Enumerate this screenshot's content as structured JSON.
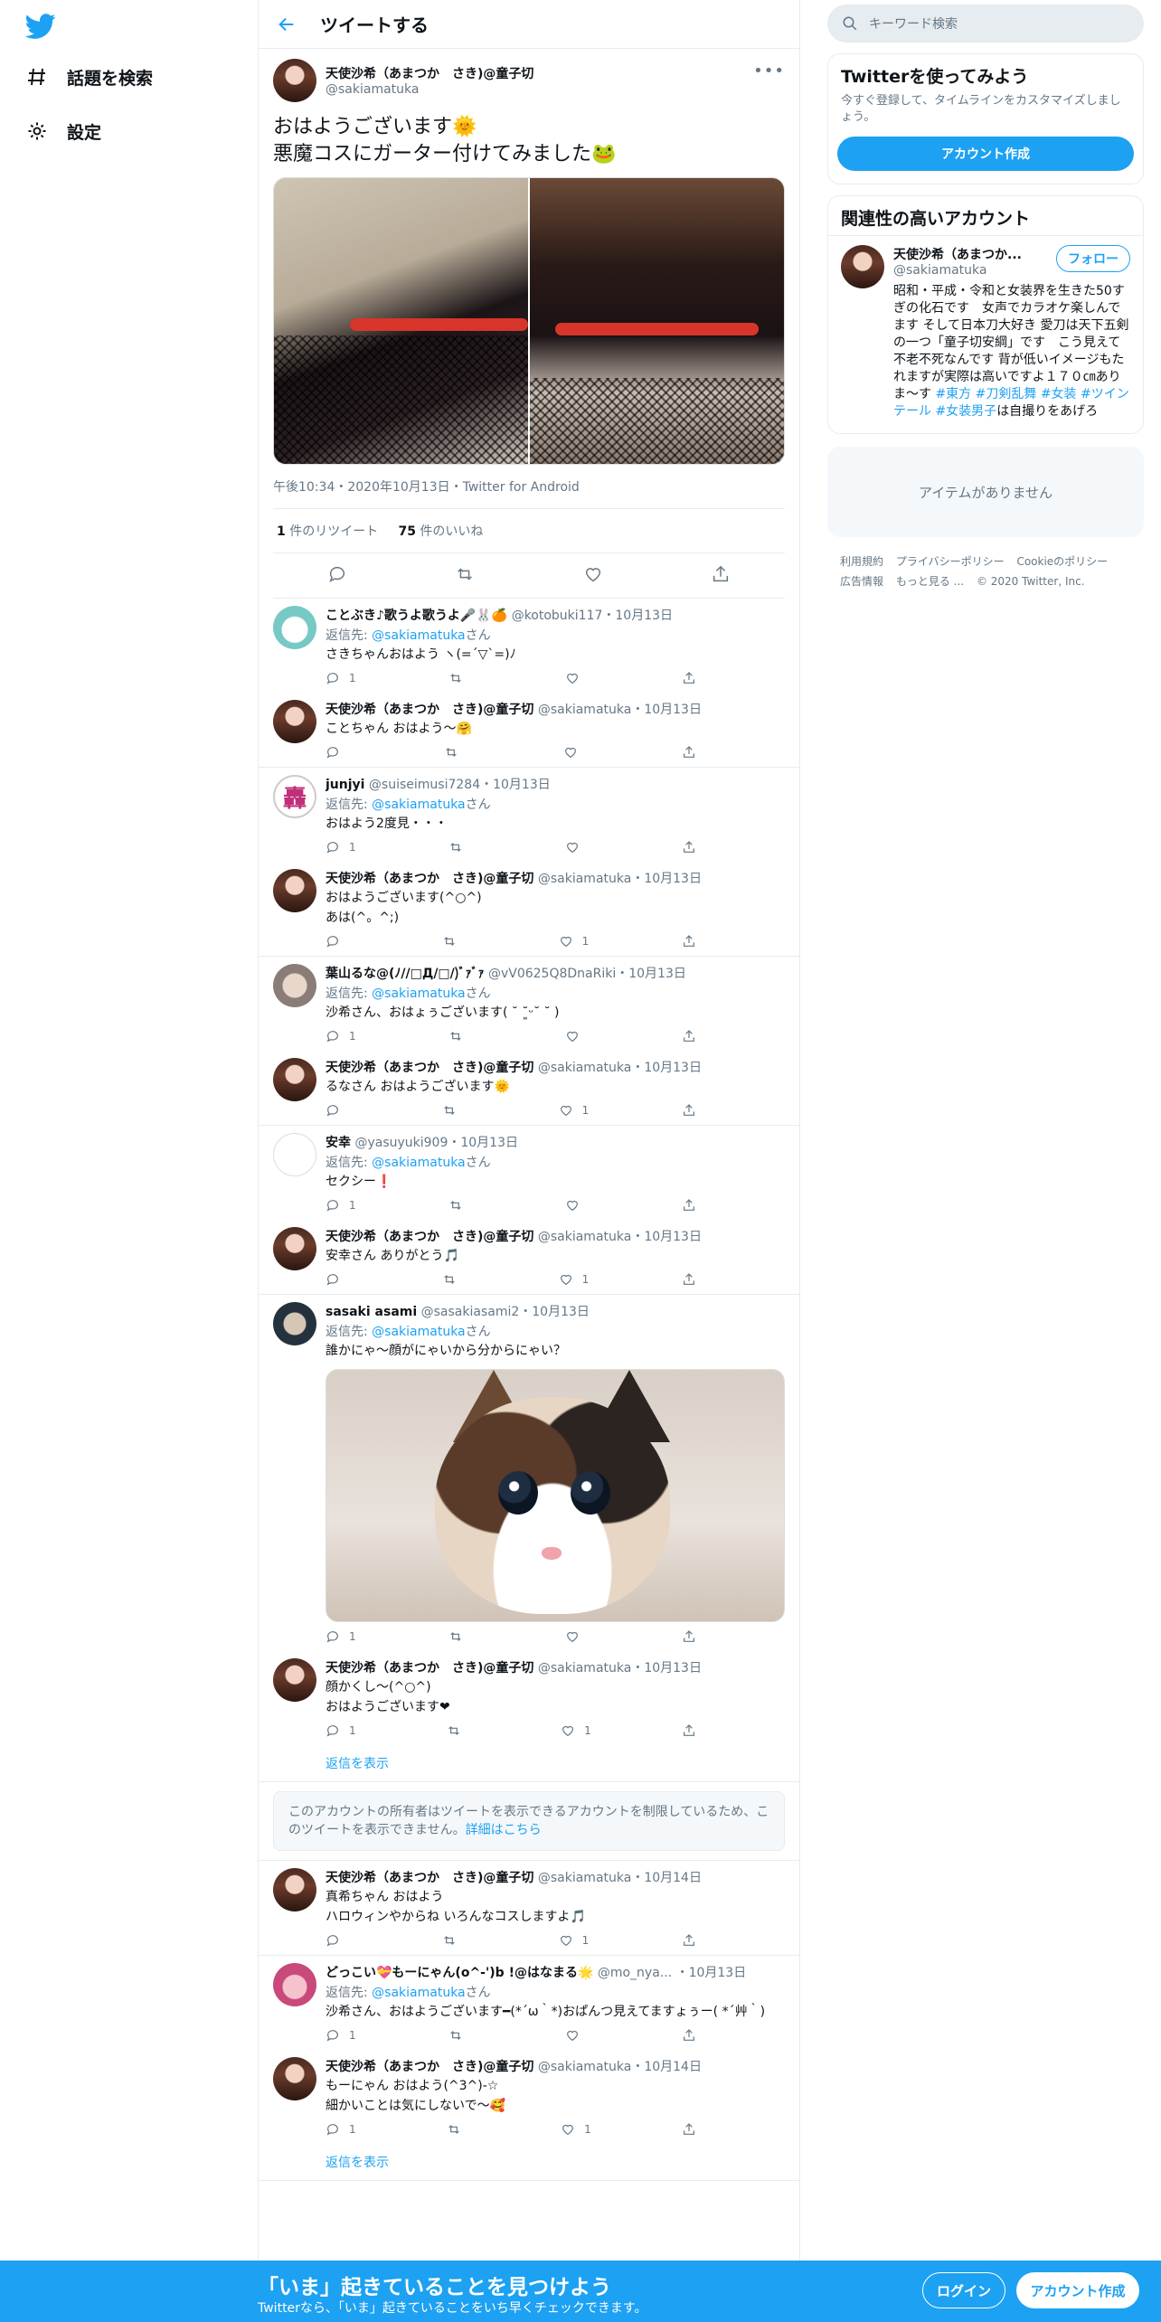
{
  "nav": {
    "explore": "話題を検索",
    "settings": "設定"
  },
  "header": {
    "title": "ツイートする"
  },
  "focal": {
    "name": "天使沙希（あまつか　さき)@童子切",
    "handle": "@sakiamatuka",
    "text_line1": "おはようございます🌞",
    "text_line2": "悪魔コスにガーター付けてみました🐸",
    "meta": "午後10:34・2020年10月13日・Twitter for Android",
    "retweets_num": "1",
    "retweets_label": "件のリツイート",
    "likes_num": "75",
    "likes_label": "件のいいね"
  },
  "reply_prefix": "返信先:",
  "reply_suffix": "さん",
  "tweets": [
    {
      "name": "ことぶき♪歌うよ歌うよ🎤🐰🍊",
      "handle": "@kotobuki117・10月13日",
      "reply_to": "@sakiamatuka",
      "text": "さきちゃんおはよう ヽ(=´▽`=)ﾉ",
      "replies": "1",
      "likes": ""
    },
    {
      "name": "天使沙希（あまつか　さき)@童子切",
      "handle": "@sakiamatuka・10月13日",
      "text": "ことちゃん おはよう〜🤗",
      "replies": "",
      "likes": ""
    },
    {
      "name": "junjyi",
      "handle": "@suiseimusi7284・10月13日",
      "reply_to": "@sakiamatuka",
      "text": "おはよう2度見・・・",
      "replies": "1",
      "likes": ""
    },
    {
      "name": "天使沙希（あまつか　さき)@童子切",
      "handle": "@sakiamatuka・10月13日",
      "text": "おはようございます(^○^)",
      "text2": "あは(^。^;)",
      "replies": "",
      "likes": "1"
    },
    {
      "name": "葉山るな@(ﾉ//□Д/□/)ﾞｧﾞｧ",
      "handle": "@vV0625Q8DnaRiki・10月13日",
      "reply_to": "@sakiamatuka",
      "text": "沙希さん、おはょぅございます( ˘ ˘͈ᵕ˘ ˘ )",
      "replies": "1",
      "likes": ""
    },
    {
      "name": "天使沙希（あまつか　さき)@童子切",
      "handle": "@sakiamatuka・10月13日",
      "text": "るなさん おはようございます🌞",
      "replies": "",
      "likes": "1"
    },
    {
      "name": "安幸",
      "handle": "@yasuyuki909・10月13日",
      "reply_to": "@sakiamatuka",
      "text": "セクシー❗",
      "replies": "1",
      "likes": ""
    },
    {
      "name": "天使沙希（あまつか　さき)@童子切",
      "handle": "@sakiamatuka・10月13日",
      "text": "安幸さん ありがとう🎵",
      "replies": "",
      "likes": "1"
    },
    {
      "name": "sasaki asami",
      "handle": "@sasakiasami2・10月13日",
      "reply_to": "@sakiamatuka",
      "text": "誰かにゃ〜顔がにゃいから分からにゃい？",
      "replies": "1",
      "likes": ""
    },
    {
      "name": "天使沙希（あまつか　さき)@童子切",
      "handle": "@sakiamatuka・10月13日",
      "text": "顔かくし〜(^○^)",
      "text2": "おはようございます❤",
      "replies": "1",
      "likes": "1"
    },
    {
      "name": "天使沙希（あまつか　さき)@童子切",
      "handle": "@sakiamatuka・10月14日",
      "text": "真希ちゃん おはよう",
      "text2": "ハロウィンやからね いろんなコスしますよ🎵",
      "replies": "",
      "likes": "1"
    },
    {
      "name": "どっこい💝もーにゃん(o^-')b !@はなまる🌟",
      "handle": "@mo_nya... ・10月13日",
      "reply_to": "@sakiamatuka",
      "text": "沙希さん、おはようございます━(*´ω｀*)おぱんつ見えてますょぅー( *´艸｀)",
      "replies": "1",
      "likes": ""
    },
    {
      "name": "天使沙希（あまつか　さき)@童子切",
      "handle": "@sakiamatuka・10月14日",
      "text": "もーにゃん おはよう(^3^)-☆",
      "text2": "細かいことは気にしないで〜🥰",
      "replies": "1",
      "likes": "1"
    }
  ],
  "show_replies": "返信を表示",
  "notice": {
    "text": "このアカウントの所有者はツイートを表示できるアカウントを制限しているため、このツイートを表示できません。",
    "link": "詳細はこちら"
  },
  "search": {
    "placeholder": "キーワード検索"
  },
  "signup_card": {
    "title": "Twitterを使ってみよう",
    "sub": "今すぐ登録して、タイムラインをカスタマイズしましょう。",
    "button": "アカウント作成"
  },
  "related": {
    "title": "関連性の高いアカウント",
    "name": "天使沙希（あまつか...",
    "handle": "@sakiamatuka",
    "follow": "フォロー",
    "desc": "昭和・平成・令和と女装界を生きた50すぎの化石です　女声でカラオケ楽しんでます そして日本刀大好き 愛刀は天下五剣の一つ「童子切安綱」です　こう見えて不老不死なんです 背が低いイメージもたれますが実際は高いですよ１７０㎝ありま～す",
    "tags": "#東方 #刀剣乱舞 #女装 #ツインテール #女装男子",
    "desc_end": "は自撮りをあげろ"
  },
  "empty": "アイテムがありません",
  "footer": {
    "terms": "利用規約",
    "privacy": "プライバシーポリシー",
    "cookie": "Cookieのポリシー",
    "ads": "広告情報",
    "more": "もっと見る ...",
    "copyright": "© 2020 Twitter, Inc."
  },
  "banner": {
    "title": "「いま」起きていることを見つけよう",
    "sub": "Twitterなら、「いま」起きていることをいち早くチェックできます。",
    "login": "ログイン",
    "signup": "アカウント作成"
  },
  "colors": {
    "accent": "#1da1f2",
    "border": "#e6ecf0",
    "muted": "#657786"
  }
}
